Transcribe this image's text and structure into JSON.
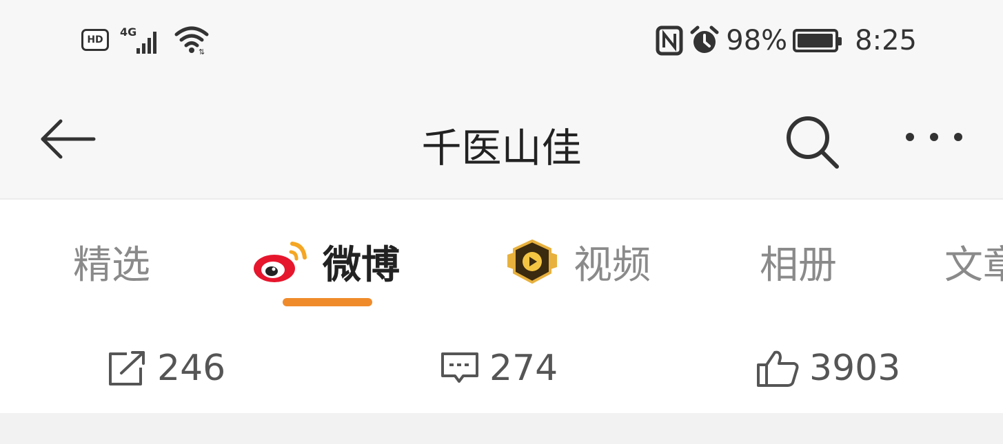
{
  "status_bar": {
    "hd_label": "HD",
    "network_label": "4G",
    "battery_percent": "98%",
    "battery_level": 0.98,
    "time": "8:25",
    "icons": [
      "hd-icon",
      "signal-4g-icon",
      "wifi-icon",
      "nfc-icon",
      "alarm-icon",
      "battery-icon"
    ]
  },
  "nav": {
    "title": "千医山佳",
    "icons": [
      "back-arrow-icon",
      "search-icon",
      "more-icon"
    ]
  },
  "tabs": [
    {
      "label": "精选",
      "active": false
    },
    {
      "label": "微博",
      "active": true,
      "icon": "weibo-logo-icon"
    },
    {
      "label": "视频",
      "active": false,
      "icon": "video-badge-icon"
    },
    {
      "label": "相册",
      "active": false
    },
    {
      "label": "文章",
      "active": false
    }
  ],
  "stats": {
    "reposts": "246",
    "comments": "274",
    "likes": "3903",
    "icons": [
      "share-icon",
      "comment-icon",
      "thumbs-up-icon"
    ]
  },
  "colors": {
    "accent": "#f08b2b",
    "header_bg": "#f7f7f7",
    "inactive_text": "#8a8a8a",
    "active_text": "#222222"
  }
}
